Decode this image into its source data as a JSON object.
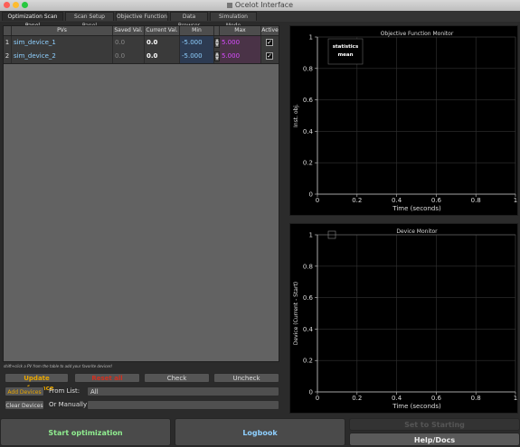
{
  "window": {
    "title": "Ocelot Interface",
    "controls": [
      "close",
      "minimize",
      "zoom"
    ]
  },
  "tabs": [
    {
      "label": "Optimization Scan Panel",
      "active": true
    },
    {
      "label": "Scan Setup Panel",
      "active": false
    },
    {
      "label": "Objective Function",
      "active": false
    },
    {
      "label": "Data Browser",
      "active": false
    },
    {
      "label": "Simulation Mode",
      "active": false
    }
  ],
  "table": {
    "headers": [
      "",
      "PVs",
      "Saved Val.",
      "Current Val.",
      "Min",
      "",
      "Max",
      "Active"
    ],
    "rows": [
      {
        "index": "1",
        "pv": "sim_device_1",
        "saved": "0.0",
        "current": "0.0",
        "min": "-5.000",
        "max": "5.000",
        "active": true
      },
      {
        "index": "2",
        "pv": "sim_device_2",
        "saved": "0.0",
        "current": "0.0",
        "min": "-5.000",
        "max": "5.000",
        "active": true
      }
    ]
  },
  "hint_text": "shift+click a PV from the table to add your favorite devices!",
  "controls": {
    "update_reference": "Update reference",
    "reset": "Reset all",
    "check": "Check",
    "uncheck": "Uncheck",
    "add_devices": "Add Devices",
    "from_list_label": "From List:",
    "from_list_value": "All",
    "clear_devices": "Clear Devices",
    "or_manually_label": "Or Manually",
    "manual_value": ""
  },
  "bottom": {
    "start": "Start optimization",
    "logbook": "Logbook",
    "disabled": "Set to Starting",
    "help": "Help/Docs"
  },
  "colors": {
    "pv_text": "#8fd0ff",
    "max_text": "#d94cff",
    "update_reference": "#e8a600",
    "reset": "#d03020",
    "add_devices": "#e8a600",
    "start": "#90ee90",
    "logbook": "#8fd0ff"
  },
  "chart_data": [
    {
      "type": "line",
      "title": "Objective Function Monitor",
      "xlabel": "Time (seconds)",
      "ylabel": "Inst. obj.",
      "xlim": [
        0,
        1
      ],
      "ylim": [
        0,
        1
      ],
      "xticks": [
        "0",
        "0.2",
        "0.4",
        "0.6",
        "0.8",
        "1"
      ],
      "yticks": [
        "0",
        "0.2",
        "0.4",
        "0.6",
        "0.8",
        "1"
      ],
      "grid": true,
      "legend": {
        "placement": "top-left",
        "entries": [
          "statistics",
          "mean"
        ]
      },
      "series": []
    },
    {
      "type": "line",
      "title": "Device Monitor",
      "xlabel": "Time (seconds)",
      "ylabel": "Device (Current - Start)",
      "xlim": [
        0,
        1
      ],
      "ylim": [
        0,
        1
      ],
      "xticks": [
        "0",
        "0.2",
        "0.4",
        "0.6",
        "0.8",
        "1"
      ],
      "yticks": [
        "0",
        "0.2",
        "0.4",
        "0.6",
        "0.8",
        "1"
      ],
      "grid": true,
      "legend": {
        "placement": "top-left",
        "entries": []
      },
      "series": []
    }
  ]
}
